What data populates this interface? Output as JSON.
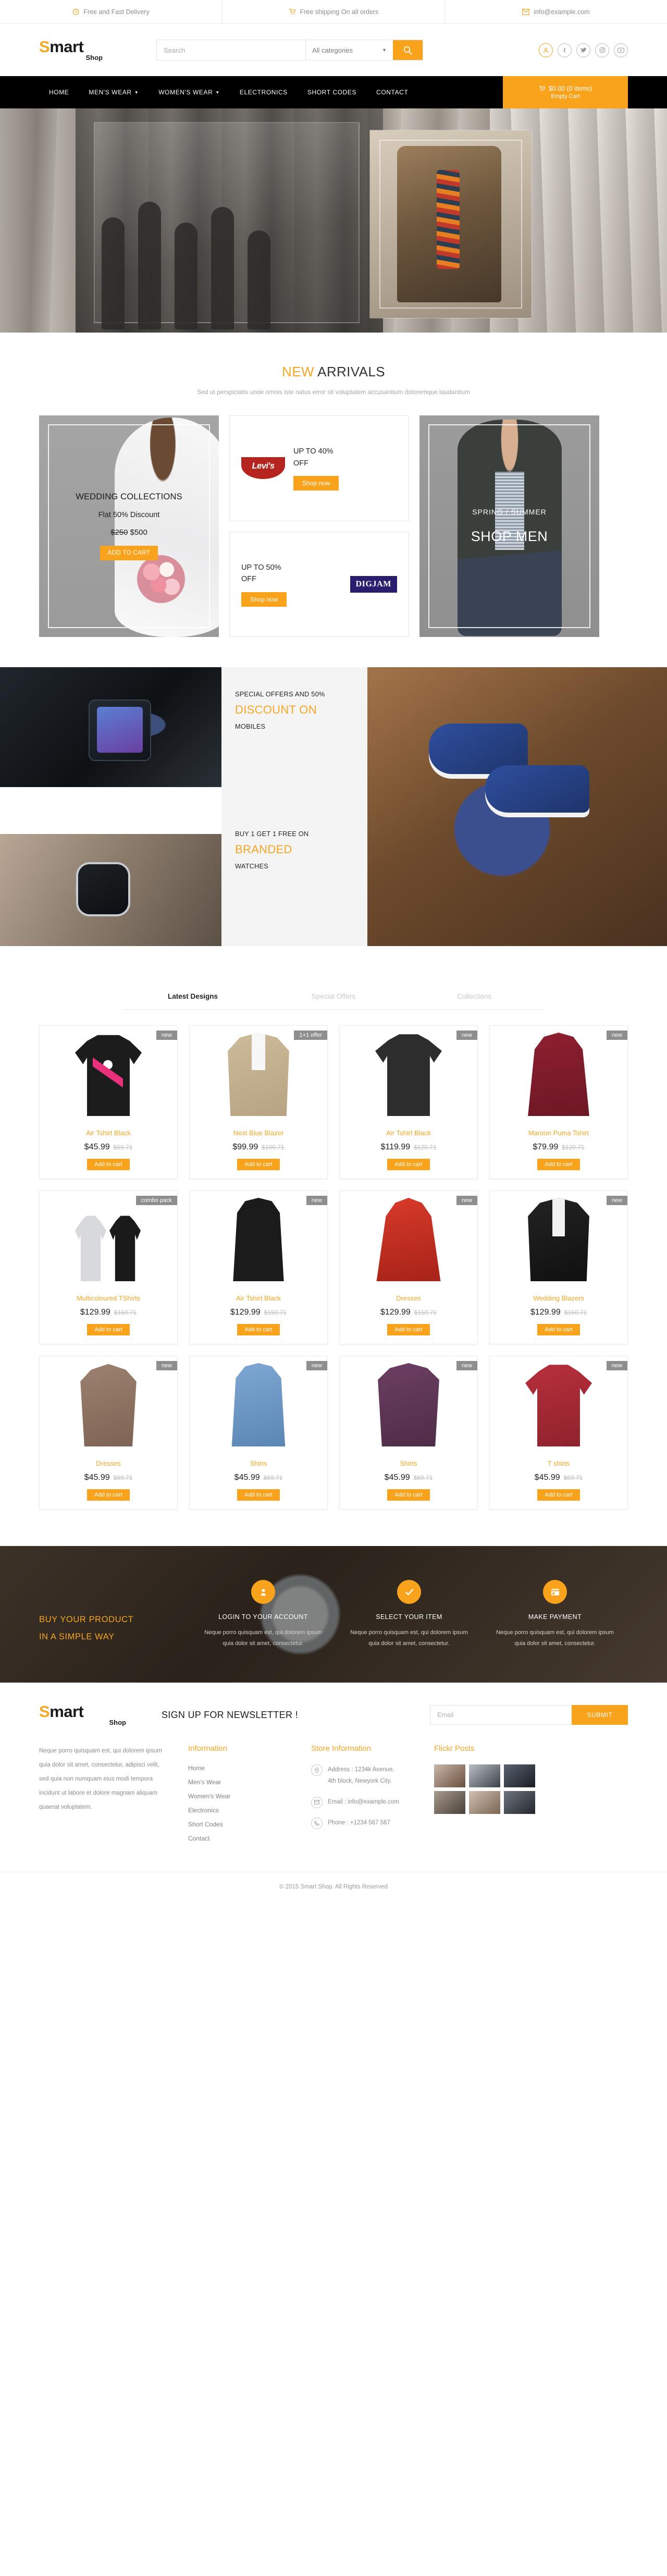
{
  "topbar": [
    {
      "icon": "clock-icon",
      "label": "Free and Fast Delivery"
    },
    {
      "icon": "cart-icon",
      "label": "Free shipping On all orders"
    },
    {
      "icon": "mail-icon",
      "label": "info@example.com"
    }
  ],
  "brand": {
    "main_s": "S",
    "main_rest": "mart",
    "sub": "Shop"
  },
  "search": {
    "placeholder": "Search",
    "category": "All categories",
    "value": ""
  },
  "social": [
    {
      "name": "user-icon",
      "glyph": "○"
    },
    {
      "name": "facebook-icon",
      "glyph": "f"
    },
    {
      "name": "twitter-icon",
      "glyph": "t"
    },
    {
      "name": "instagram-icon",
      "glyph": "▣"
    },
    {
      "name": "youtube-icon",
      "glyph": "▶"
    }
  ],
  "nav": {
    "items": [
      {
        "label": "HOME",
        "caret": false
      },
      {
        "label": "MEN'S WEAR",
        "caret": true
      },
      {
        "label": "WOMEN'S WEAR",
        "caret": true
      },
      {
        "label": "ELECTRONICS",
        "caret": false
      },
      {
        "label": "SHORT CODES",
        "caret": false
      },
      {
        "label": "CONTACT",
        "caret": false
      }
    ],
    "cart": {
      "total": "$0.00 (0 items)",
      "sub": "Empty Cart"
    }
  },
  "new_arrivals": {
    "title_hl": "NEW",
    "title_rest": " ARRIVALS",
    "subtitle": "Sed ut perspiciatis unde omnis iste natus error sit voluptatem accusantium doloremque laudantium",
    "wedding": {
      "heading": "WEDDING COLLECTIONS",
      "line": "Flat 50% Discount",
      "old_price": "$250",
      "price": "$500",
      "button": "ADD TO CART"
    },
    "levis": {
      "line1": "UP TO 40%",
      "line2": "OFF",
      "button": "Shop now",
      "logo": "Levi's"
    },
    "digjam": {
      "line1": "UP TO 50%",
      "line2": "OFF",
      "button": "Shop now",
      "logo": "DIGJAM"
    },
    "men": {
      "heading": "SPRING / SUMMER",
      "big": "SHOP MEN"
    }
  },
  "offers": {
    "mobiles": {
      "l1": "SPECIAL OFFERS AND 50%",
      "l2": "DISCOUNT ON",
      "l3": "MOBILES"
    },
    "watches": {
      "l1": "BUY 1 GET 1 FREE ON",
      "l2": "BRANDED",
      "l3": "WATCHES"
    }
  },
  "tabs": [
    {
      "label": "Latest Designs",
      "active": true
    },
    {
      "label": "Special Offers",
      "active": false
    },
    {
      "label": "Collections",
      "active": false
    }
  ],
  "products": [
    {
      "name": "Air Tshirt Black",
      "price": "$45.99",
      "old": "$69.71",
      "badge": "new",
      "art": "art-tee-black",
      "btn": "Add to cart"
    },
    {
      "name": "Next Blue Blazer",
      "price": "$99.99",
      "old": "$100.71",
      "badge": "1+1 offer",
      "art": "art-blazer-tan",
      "btn": "Add to cart"
    },
    {
      "name": "Air Tshirt Black",
      "price": "$119.99",
      "old": "$120.71",
      "badge": "new",
      "art": "art-tee-dark",
      "btn": "Add to cart"
    },
    {
      "name": "Maroon Puma Tshirt",
      "price": "$79.99",
      "old": "$120.71",
      "badge": "new",
      "art": "art-dress-maroon",
      "btn": "Add to cart"
    },
    {
      "name": "Multicoloured TShirts",
      "price": "$129.99",
      "old": "$150.71",
      "badge": "combo pack",
      "art": "art-combo",
      "btn": "Add to cart"
    },
    {
      "name": "Air Tshirt Black",
      "price": "$129.99",
      "old": "$150.71",
      "badge": "new",
      "art": "art-vest-black",
      "btn": "Add to cart"
    },
    {
      "name": "Dresses",
      "price": "$129.99",
      "old": "$150.71",
      "badge": "new",
      "art": "art-dress-red",
      "btn": "Add to cart"
    },
    {
      "name": "Wedding Blazers",
      "price": "$129.99",
      "old": "$150.71",
      "badge": "new",
      "art": "art-blazer-black",
      "btn": "Add to cart"
    },
    {
      "name": "Dresses",
      "price": "$45.99",
      "old": "$69.71",
      "badge": "new",
      "art": "art-top-brown",
      "btn": "Add to cart"
    },
    {
      "name": "Shirts",
      "price": "$45.99",
      "old": "$69.71",
      "badge": "new",
      "art": "art-vest-blue",
      "btn": "Add to cart"
    },
    {
      "name": "Shirts",
      "price": "$45.99",
      "old": "$69.71",
      "badge": "new",
      "art": "art-shirt-purple",
      "btn": "Add to cart"
    },
    {
      "name": "T shirts",
      "price": "$45.99",
      "old": "$69.71",
      "badge": "new",
      "art": "art-tee-red",
      "btn": "Add to cart"
    }
  ],
  "steps": {
    "title_l1": "BUY YOUR PRODUCT",
    "title_l2": "IN A SIMPLE WAY",
    "items": [
      {
        "icon": "person-icon",
        "glyph": "♟",
        "name": "LOGIN TO YOUR ACCOUNT",
        "desc": "Neque porro quisquam est, qui dolorem ipsum quia dolor sit amet, consectetur."
      },
      {
        "icon": "check-icon",
        "glyph": "✓",
        "name": "SELECT YOUR ITEM",
        "desc": "Neque porro quisquam est, qui dolorem ipsum quia dolor sit amet, consectetur."
      },
      {
        "icon": "card-icon",
        "glyph": "▤",
        "name": "MAKE PAYMENT",
        "desc": "Neque porro quisquam est, qui dolorem ipsum quia dolor sit amet, consectetur."
      }
    ]
  },
  "footer": {
    "newsletter_title": "SIGN UP FOR NEWSLETTER !",
    "email_placeholder": "Email",
    "submit_label": "SUBMIT",
    "about": "Neque porro quisquam est, qui dolorem ipsum quia dolor sit amet, consectetur, adipisci velit, sed quia non numquam eius modi tempora incidunt ut labore et dolore magnam aliquam quaerat voluptatem.",
    "information": {
      "heading": "Information",
      "links": [
        "Home",
        "Men's Wear",
        "Women's Wear",
        "Electronics",
        "Short Codes",
        "Contact"
      ]
    },
    "store": {
      "heading": "Store Information",
      "address_label": "Address : 1234k Avenue,",
      "address_line2": "4th block, Newyork City.",
      "email": "Email : info@example.com",
      "phone": "Phone : +1234 567 567"
    },
    "flickr": {
      "heading": "Flickr Posts"
    },
    "copyright": "© 2015 Smart Shop. All Rights Reserved"
  }
}
